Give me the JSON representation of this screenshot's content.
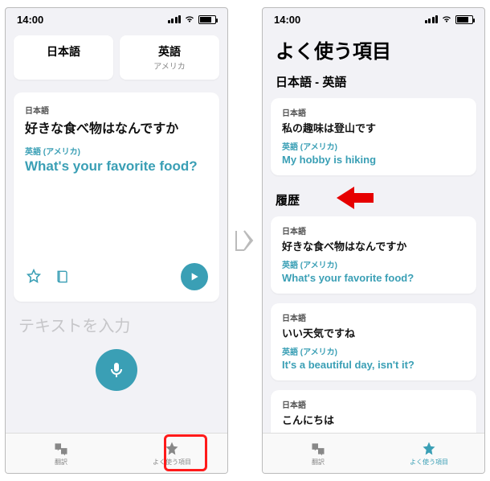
{
  "status": {
    "time": "14:00"
  },
  "left": {
    "lang_source": "日本語",
    "lang_target": "英語",
    "lang_target_sub": "アメリカ",
    "card": {
      "src_label": "日本語",
      "src_text": "好きな食べ物はなんですか",
      "trg_label": "英語 (アメリカ)",
      "trg_text": "What's your favorite food?"
    },
    "input_placeholder": "テキストを入力",
    "tabs": {
      "translate": "翻訳",
      "favorites": "よく使う項目"
    }
  },
  "right": {
    "title": "よく使う項目",
    "pair": "日本語 - 英語",
    "fav": {
      "src_label": "日本語",
      "src_text": "私の趣味は登山です",
      "trg_label": "英語 (アメリカ)",
      "trg_text": "My hobby is hiking"
    },
    "history_header": "履歴",
    "history": [
      {
        "src_label": "日本語",
        "src_text": "好きな食べ物はなんですか",
        "trg_label": "英語 (アメリカ)",
        "trg_text": "What's your favorite food?"
      },
      {
        "src_label": "日本語",
        "src_text": "いい天気ですね",
        "trg_label": "英語 (アメリカ)",
        "trg_text": "It's a beautiful day, isn't it?"
      },
      {
        "src_label": "日本語",
        "src_text": "こんにちは",
        "trg_label": "",
        "trg_text": ""
      }
    ],
    "tabs": {
      "translate": "翻訳",
      "favorites": "よく使う項目"
    }
  }
}
